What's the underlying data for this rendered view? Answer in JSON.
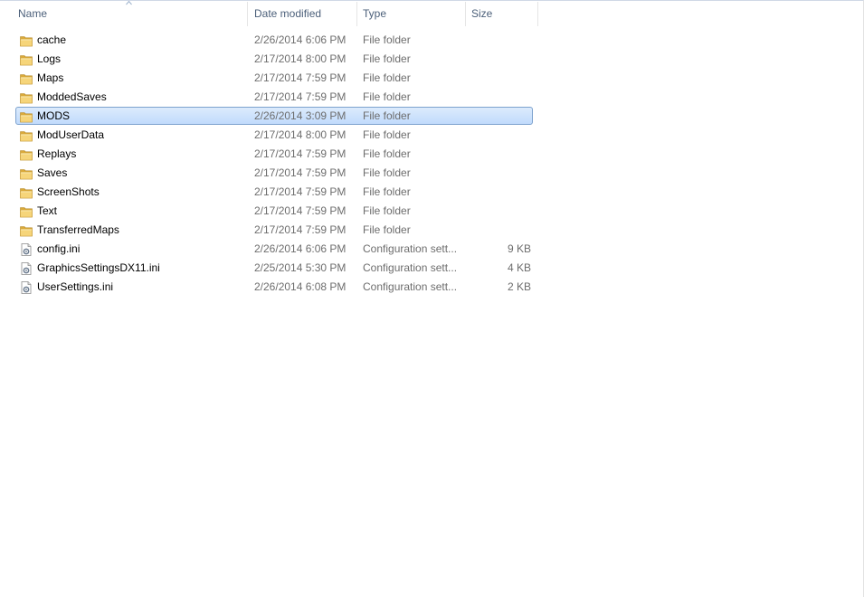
{
  "columns": {
    "name": "Name",
    "date": "Date modified",
    "type": "Type",
    "size": "Size",
    "sorted_by": "Name",
    "sort_direction": "ascending"
  },
  "colors": {
    "header_text": "#4c607a",
    "secondary_text": "#6d6d6d",
    "selection_border": "#7da2ce",
    "selection_fill": "#cce0fb",
    "folder_icon": "#e8c15a"
  },
  "items": [
    {
      "name": "cache",
      "date": "2/26/2014 6:06 PM",
      "type": "File folder",
      "size": "",
      "icon": "folder-icon",
      "selected": false
    },
    {
      "name": "Logs",
      "date": "2/17/2014 8:00 PM",
      "type": "File folder",
      "size": "",
      "icon": "folder-icon",
      "selected": false
    },
    {
      "name": "Maps",
      "date": "2/17/2014 7:59 PM",
      "type": "File folder",
      "size": "",
      "icon": "folder-icon",
      "selected": false
    },
    {
      "name": "ModdedSaves",
      "date": "2/17/2014 7:59 PM",
      "type": "File folder",
      "size": "",
      "icon": "folder-icon",
      "selected": false
    },
    {
      "name": "MODS",
      "date": "2/26/2014 3:09 PM",
      "type": "File folder",
      "size": "",
      "icon": "folder-icon",
      "selected": true
    },
    {
      "name": "ModUserData",
      "date": "2/17/2014 8:00 PM",
      "type": "File folder",
      "size": "",
      "icon": "folder-icon",
      "selected": false
    },
    {
      "name": "Replays",
      "date": "2/17/2014 7:59 PM",
      "type": "File folder",
      "size": "",
      "icon": "folder-icon",
      "selected": false
    },
    {
      "name": "Saves",
      "date": "2/17/2014 7:59 PM",
      "type": "File folder",
      "size": "",
      "icon": "folder-icon",
      "selected": false
    },
    {
      "name": "ScreenShots",
      "date": "2/17/2014 7:59 PM",
      "type": "File folder",
      "size": "",
      "icon": "folder-icon",
      "selected": false
    },
    {
      "name": "Text",
      "date": "2/17/2014 7:59 PM",
      "type": "File folder",
      "size": "",
      "icon": "folder-icon",
      "selected": false
    },
    {
      "name": "TransferredMaps",
      "date": "2/17/2014 7:59 PM",
      "type": "File folder",
      "size": "",
      "icon": "folder-icon",
      "selected": false
    },
    {
      "name": "config.ini",
      "date": "2/26/2014 6:06 PM",
      "type": "Configuration sett...",
      "size": "9 KB",
      "icon": "config-file-icon",
      "selected": false
    },
    {
      "name": "GraphicsSettingsDX11.ini",
      "date": "2/25/2014 5:30 PM",
      "type": "Configuration sett...",
      "size": "4 KB",
      "icon": "config-file-icon",
      "selected": false
    },
    {
      "name": "UserSettings.ini",
      "date": "2/26/2014 6:08 PM",
      "type": "Configuration sett...",
      "size": "2 KB",
      "icon": "config-file-icon",
      "selected": false
    }
  ]
}
